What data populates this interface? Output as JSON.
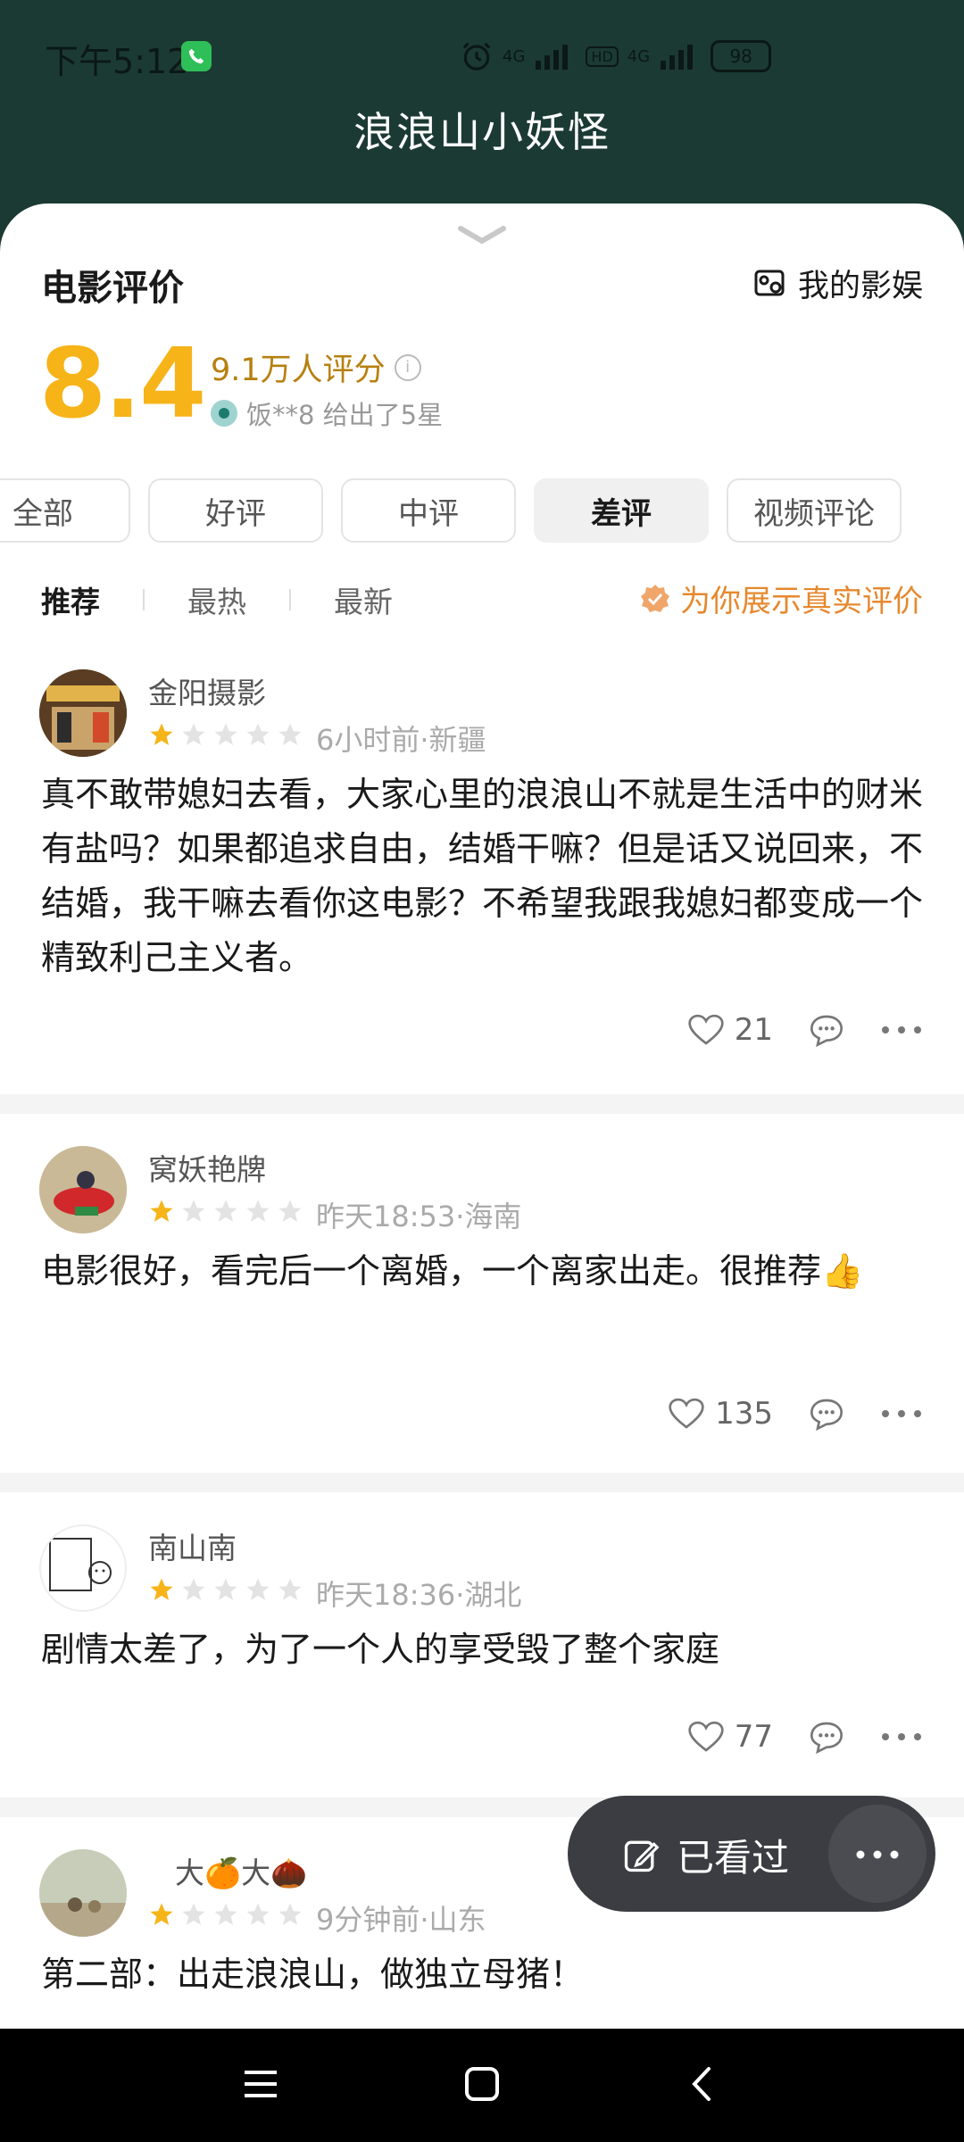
{
  "status": {
    "time": "下午5:12",
    "battery": "98",
    "net1": "4G",
    "net2": "HD",
    "net3": "4G"
  },
  "header": {
    "title": "浪浪山小妖怪"
  },
  "section": {
    "title": "电影评价",
    "my_movie": "我的影娱"
  },
  "rating": {
    "score": "8.4",
    "count": "9.1万人评分",
    "friend": "饭**8 给出了5星"
  },
  "filters": [
    "全部",
    "好评",
    "中评",
    "差评",
    "视频评论"
  ],
  "sorts": [
    "推荐",
    "最热",
    "最新"
  ],
  "real_label": "为你展示真实评价",
  "reviews": [
    {
      "name": "金阳摄影",
      "stars": 1,
      "time": "6小时前·新疆",
      "text": "真不敢带媳妇去看，大家心里的浪浪山不就是生活中的财米有盐吗？如果都追求自由，结婚干嘛？但是话又说回来，不结婚，我干嘛去看你这电影？不希望我跟我媳妇都变成一个精致利己主义者。",
      "likes": "21"
    },
    {
      "name": "窝妖艳牌",
      "stars": 1,
      "time": "昨天18:53·海南",
      "text": "电影很好，看完后一个离婚，一个离家出走。很推荐👍",
      "likes": "135"
    },
    {
      "name": "南山南",
      "stars": 1,
      "time": "昨天18:36·湖北",
      "text": "剧情太差了，为了一个人的享受毁了整个家庭",
      "likes": "77"
    },
    {
      "name": "大🍊大🌰",
      "stars": 1,
      "time": "9分钟前·山东",
      "text": "第二部：出走浪浪山，做独立母猪！",
      "likes": ""
    }
  ],
  "float": {
    "watched": "已看过"
  },
  "colors": {
    "header_bg": "#1b3a33",
    "score": "#f6b419",
    "accent": "#e6882d",
    "star_on": "#f6b419",
    "star_off": "#e3e3e3"
  }
}
